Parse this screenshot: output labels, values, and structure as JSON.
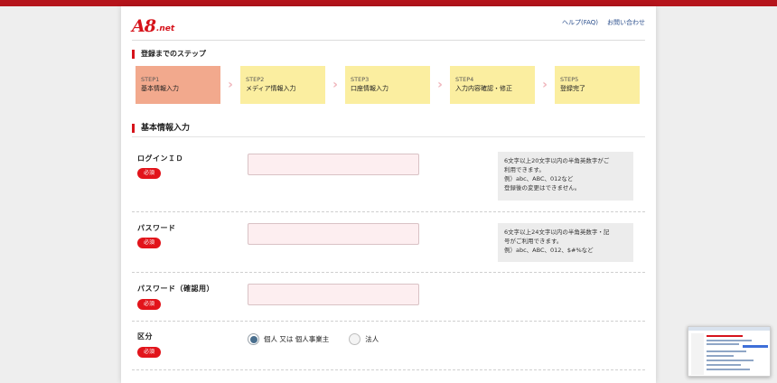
{
  "header": {
    "logo_a8": "A8",
    "logo_net": ".net",
    "help_link": "ヘルプ(FAQ)",
    "contact_link": "お問い合わせ"
  },
  "steps_section": {
    "title": "登録までのステップ",
    "steps": [
      {
        "num": "STEP1",
        "name": "基本情報入力",
        "active": true
      },
      {
        "num": "STEP2",
        "name": "メディア情報入力",
        "active": false
      },
      {
        "num": "STEP3",
        "name": "口座情報入力",
        "active": false
      },
      {
        "num": "STEP4",
        "name": "入力内容確認・修正",
        "active": false
      },
      {
        "num": "STEP5",
        "name": "登録完了",
        "active": false
      }
    ]
  },
  "form": {
    "title": "基本情報入力",
    "required_label": "必須",
    "login_id": {
      "label": "ログインＩＤ",
      "value": "",
      "note": [
        "6文字以上20文字以内の半角英数字がご",
        "利用できます。",
        "例）abc、ABC、012など",
        "登録後の変更はできません。"
      ]
    },
    "password": {
      "label": "パスワード",
      "value": "",
      "note": [
        "6文字以上24文字以内の半角英数字・記",
        "号がご利用できます。",
        "例）abc、ABC、012、$#%など"
      ]
    },
    "password_confirm": {
      "label": "パスワード（確認用）",
      "value": ""
    },
    "category": {
      "label": "区分",
      "options": [
        {
          "label": "個人 又は 個人事業主",
          "checked": true
        },
        {
          "label": "法人",
          "checked": false
        }
      ]
    }
  },
  "colors": {
    "brand_red": "#d6131b",
    "step_active": "#f2a98d",
    "step_inactive": "#fbeea0",
    "input_bg": "#fdeef0"
  }
}
